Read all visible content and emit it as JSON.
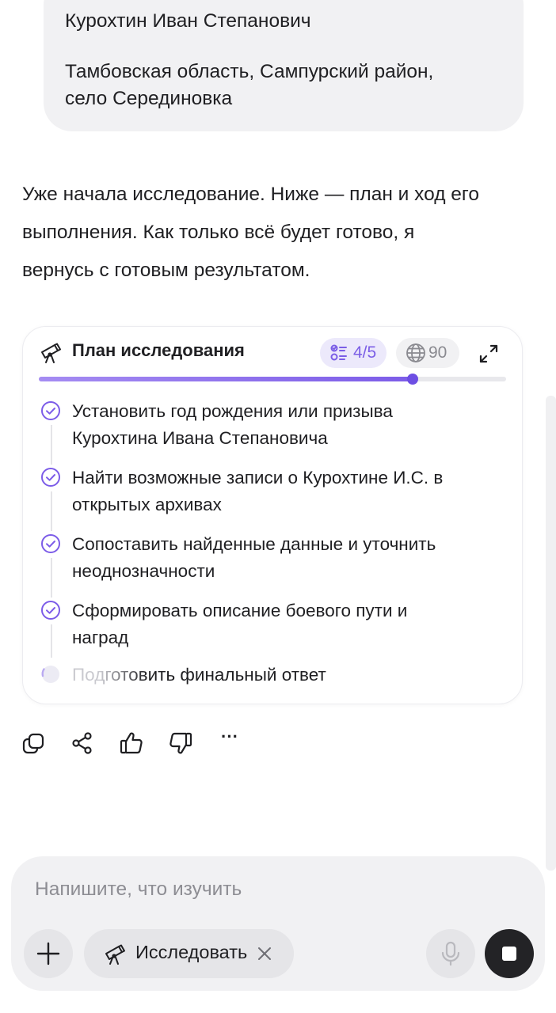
{
  "user_message": {
    "name": "Курохтин Иван Степанович",
    "location_line1": "Тамбовская область, Сампурский район,",
    "location_line2": "село Серединовка"
  },
  "assistant_message": {
    "line1": "Уже начала исследование. Ниже — план и ход его",
    "line2": "выполнения. Как только всё будет готово, я",
    "line3": "вернусь с готовым результатом."
  },
  "plan": {
    "title": "План исследования",
    "steps_badge": "4/5",
    "sources_badge": "90",
    "progress": 0.8,
    "accent_color": "#7c5ce8",
    "steps": [
      {
        "line1": "Установить год рождения или призыва",
        "line2": "Курохтина Ивана Степановича",
        "status": "done"
      },
      {
        "line1": "Найти возможные записи о Курохтине И.С. в",
        "line2": "открытых архивах",
        "status": "done"
      },
      {
        "line1": "Сопоставить найденные данные и уточнить",
        "line2": "неоднозначности",
        "status": "done"
      },
      {
        "line1": "Сформировать описание боевого пути и",
        "line2": "наград",
        "status": "done"
      },
      {
        "line1": "Подготовить финальный ответ",
        "line2": "",
        "status": "in-progress"
      }
    ]
  },
  "actions": {
    "icons": [
      "copy-icon",
      "share-icon",
      "thumbs-up-icon",
      "thumbs-down-icon",
      "more-icon"
    ],
    "more_glyph": "···"
  },
  "composer": {
    "placeholder": "Напишите, что изучить",
    "mode_label": "Исследовать",
    "add_icon": "plus-icon",
    "mic_icon": "microphone-icon",
    "stop_icon": "stop-icon"
  }
}
